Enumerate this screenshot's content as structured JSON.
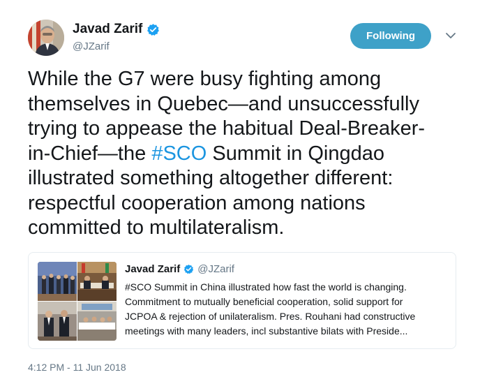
{
  "author": {
    "name": "Javad Zarif",
    "handle": "@JZarif",
    "verified": true,
    "avatar_icon": "profile-photo"
  },
  "follow_button": {
    "label": "Following",
    "color": "#3ea1c8"
  },
  "menu_icon": "chevron-down-icon",
  "tweet": {
    "lines": [
      "While the G7 were busy fighting among",
      "themselves in Quebec—and unsuccessfully",
      "trying to appease the habitual Deal-Breaker-",
      "in-Chief—the ",
      "#SCO",
      " Summit in Qingdao",
      "illustrated something altogether different:",
      "respectful cooperation among nations",
      "committed to multilateralism."
    ],
    "hashtag_color": "#1b95e0"
  },
  "quoted_tweet": {
    "name": "Javad Zarif",
    "handle": "@JZarif",
    "verified": true,
    "text_lines": [
      "#SCO Summit in China illustrated how fast the world is changing.",
      "Commitment to mutually beneficial cooperation, solid support for",
      "JCPOA & rejection of unilateralism. Pres. Rouhani had constructive",
      "meetings with many leaders, incl substantive bilats with Preside..."
    ],
    "media_count": 4
  },
  "timestamp": "4:12 PM - 11 Jun 2018",
  "colors": {
    "text": "#14171a",
    "secondary": "#657786",
    "verified": "#1da1f2",
    "border": "#e6ecf0"
  }
}
